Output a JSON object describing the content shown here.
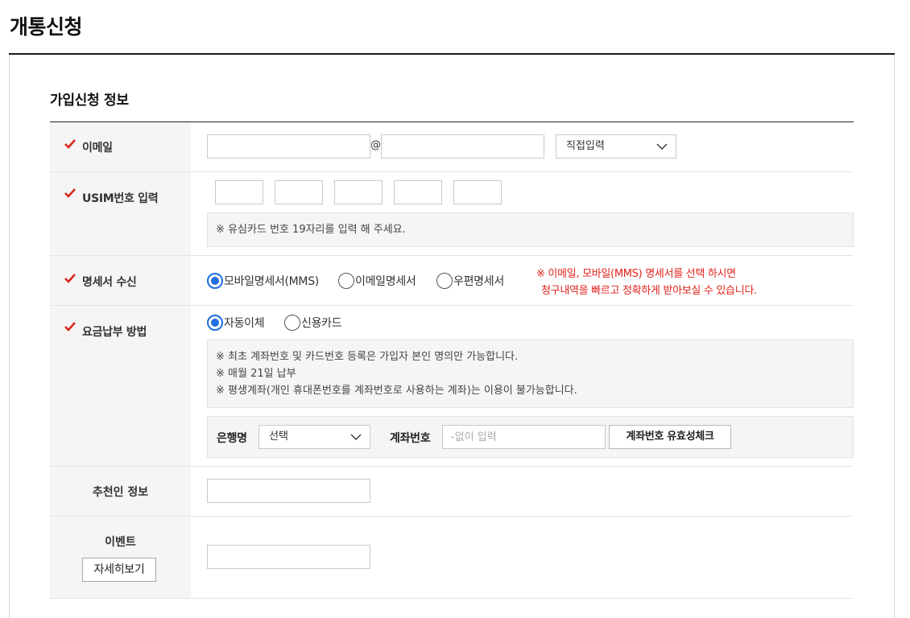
{
  "page": {
    "title": "개통신청"
  },
  "section": {
    "title": "가입신청 정보"
  },
  "email": {
    "label": "이메일",
    "at": "@",
    "domain_select": "직접입력"
  },
  "usim": {
    "label": "USIM번호 입력",
    "notice": "※ 유심카드 번호 19자리를 입력 해 주세요."
  },
  "statement": {
    "label": "명세서 수신",
    "options": [
      "모바일명세서(MMS)",
      "이메일명세서",
      "우편명세서"
    ],
    "selected": "모바일명세서(MMS)",
    "note_line1": "※ 이메일, 모바일(MMS) 명세서를 선택 하시면",
    "note_line2": "청구내역을 빠르고 정확하게 받아보실 수 있습니다."
  },
  "payment": {
    "label": "요금납부 방법",
    "options": [
      "자동이체",
      "신용카드"
    ],
    "selected": "자동이체",
    "notice_line1": "※ 최초 계좌번호 및 카드번호 등록은 가입자 본인 명의만 가능합니다.",
    "notice_line2": "※ 매월 21일 납부",
    "notice_line3": "※ 평생계좌(개인 휴대폰번호를 계좌번호로 사용하는 계좌)는 이용이 불가능합니다.",
    "bank_label": "은행명",
    "bank_select": "선택",
    "account_label": "계좌번호",
    "account_placeholder": "-없이 입력",
    "check_button": "계좌번호 유효성체크"
  },
  "referrer": {
    "label": "추천인 정보"
  },
  "event": {
    "label": "이벤트",
    "detail_button": "자세히보기"
  },
  "colors": {
    "accent_red": "#e0221a",
    "radio_blue": "#1f6fe0"
  }
}
